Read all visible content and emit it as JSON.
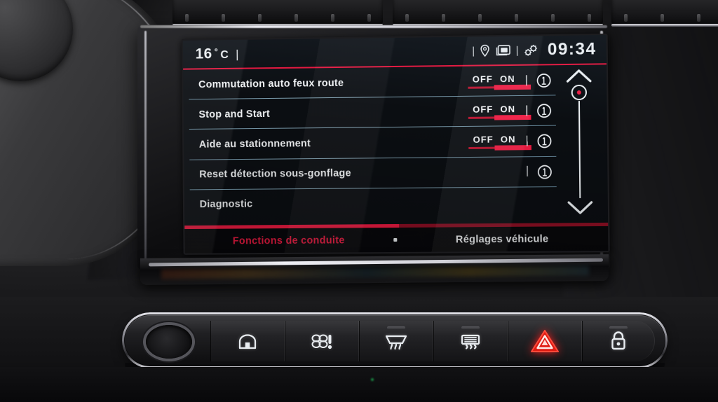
{
  "statusbar": {
    "temperature": "16",
    "degree_symbol": "°",
    "unit": "C",
    "separator_bar": "|",
    "pipe_left": "|",
    "pipe_right": "|",
    "location_icon": "location-pin-icon",
    "windows_icon": "stacked-cards-icon",
    "gears_icon": "gears-icon",
    "clock": "09:34"
  },
  "menu": {
    "rows": [
      {
        "label": "Commutation auto feux route",
        "has_toggle": true,
        "off_label": "OFF",
        "on_label": "ON",
        "selected": "ON",
        "pipe": "|",
        "info_icon": "info-circle-icon"
      },
      {
        "label": "Stop and Start",
        "has_toggle": true,
        "off_label": "OFF",
        "on_label": "ON",
        "selected": "ON",
        "pipe": "|",
        "info_icon": "info-circle-icon"
      },
      {
        "label": "Aide au stationnement",
        "has_toggle": true,
        "off_label": "OFF",
        "on_label": "ON",
        "selected": "ON",
        "pipe": "|",
        "info_icon": "info-circle-icon"
      },
      {
        "label": "Reset détection sous-gonflage",
        "has_toggle": false,
        "off_label": "",
        "on_label": "",
        "selected": "",
        "pipe": "|",
        "info_icon": "info-circle-icon"
      },
      {
        "label": "Diagnostic",
        "has_toggle": false,
        "off_label": "",
        "on_label": "",
        "selected": "",
        "pipe": "",
        "info_icon": ""
      }
    ]
  },
  "scrollbar": {
    "up_icon": "chevron-up-icon",
    "down_icon": "chevron-down-icon",
    "thumb_icon": "scroll-thumb-icon",
    "position_percent": 0
  },
  "tabs": [
    {
      "label": "Fonctions de conduite",
      "active": true
    },
    {
      "label": "Réglages véhicule",
      "active": false
    }
  ],
  "hardware_buttons": [
    {
      "name": "volume-knob",
      "icon": "rotary-knob-icon"
    },
    {
      "name": "home-button",
      "icon": "home-icon"
    },
    {
      "name": "climate-button",
      "icon": "fan-climate-icon"
    },
    {
      "name": "front-defrost-button",
      "icon": "front-defrost-icon"
    },
    {
      "name": "rear-defrost-button",
      "icon": "rear-defrost-icon"
    },
    {
      "name": "hazard-button",
      "icon": "hazard-triangle-icon"
    },
    {
      "name": "door-lock-button",
      "icon": "lock-icon"
    }
  ],
  "colors": {
    "accent_red": "#ef1b42",
    "dim_red": "#b8102c",
    "tab_bar_red": "#8d0f24",
    "divider_blue": "#9ec4d6",
    "screen_bg": "#0b0e12",
    "text_white": "#f3f5f7"
  }
}
